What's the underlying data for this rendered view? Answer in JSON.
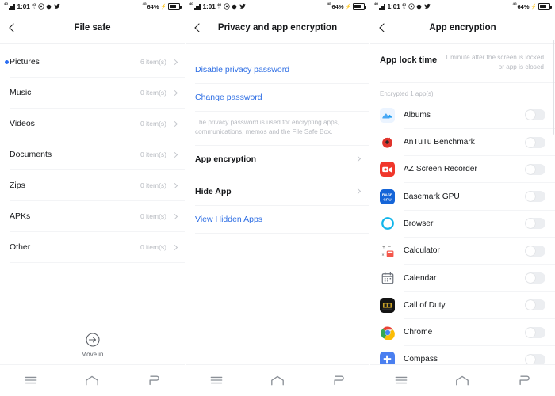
{
  "status_bar": {
    "network_label": "4G",
    "signal_icon": "signal-bars-icon",
    "time": "1:01",
    "data_icon": "mobile-data-icon",
    "dnd_icon": "do-not-disturb-icon",
    "record_icon": "record-dot-icon",
    "twitter_icon": "twitter-bird-icon",
    "battery_network_label": "4G",
    "battery_percent": "64%",
    "charging_icon": "charging-bolt-icon",
    "battery_icon": "battery-icon"
  },
  "nav_bar": {
    "recents_label": "recents-icon",
    "home_label": "home-icon",
    "back_label": "back-icon"
  },
  "panel1": {
    "title": "File safe",
    "back_icon": "back-chevron-icon",
    "items": [
      {
        "name": "Pictures",
        "count": "6 item(s)",
        "selected": true
      },
      {
        "name": "Music",
        "count": "0 item(s)",
        "selected": false
      },
      {
        "name": "Videos",
        "count": "0 item(s)",
        "selected": false
      },
      {
        "name": "Documents",
        "count": "0 item(s)",
        "selected": false
      },
      {
        "name": "Zips",
        "count": "0 item(s)",
        "selected": false
      },
      {
        "name": "APKs",
        "count": "0 item(s)",
        "selected": false
      },
      {
        "name": "Other",
        "count": "0 item(s)",
        "selected": false
      }
    ],
    "move_in_label": "Move in",
    "move_in_icon": "move-in-arrow-icon"
  },
  "panel2": {
    "title": "Privacy and app encryption",
    "back_icon": "back-chevron-icon",
    "disable_privacy_password": "Disable privacy password",
    "change_password": "Change password",
    "description": "The privacy password is used for encrypting apps, communications, memos and the File Safe Box.",
    "app_encryption": "App encryption",
    "hide_app": "Hide App",
    "view_hidden_apps": "View Hidden Apps"
  },
  "panel3": {
    "title": "App encryption",
    "back_icon": "back-chevron-icon",
    "app_lock_time_label": "App lock time",
    "app_lock_time_value": "1 minute after the screen is locked or app is closed",
    "encrypted_header": "Encrypted 1 app(s)",
    "apps": [
      {
        "name": "Albums",
        "icon": "albums-icon",
        "enabled": false
      },
      {
        "name": "AnTuTu Benchmark",
        "icon": "antutu-icon",
        "enabled": false
      },
      {
        "name": "AZ Screen Recorder",
        "icon": "az-screen-recorder-icon",
        "enabled": false
      },
      {
        "name": "Basemark GPU",
        "icon": "basemark-gpu-icon",
        "enabled": false
      },
      {
        "name": "Browser",
        "icon": "browser-icon",
        "enabled": false
      },
      {
        "name": "Calculator",
        "icon": "calculator-icon",
        "enabled": false
      },
      {
        "name": "Calendar",
        "icon": "calendar-icon",
        "enabled": false
      },
      {
        "name": "Call of Duty",
        "icon": "call-of-duty-icon",
        "enabled": false
      },
      {
        "name": "Chrome",
        "icon": "chrome-icon",
        "enabled": false
      },
      {
        "name": "Compass",
        "icon": "compass-icon",
        "enabled": false
      }
    ]
  },
  "colors": {
    "link_blue": "#2f6fe4",
    "accent_dot": "#2b6ef2",
    "text_primary": "#15171a",
    "text_muted": "#b7bac0",
    "toggle_off": "#eceef1"
  }
}
